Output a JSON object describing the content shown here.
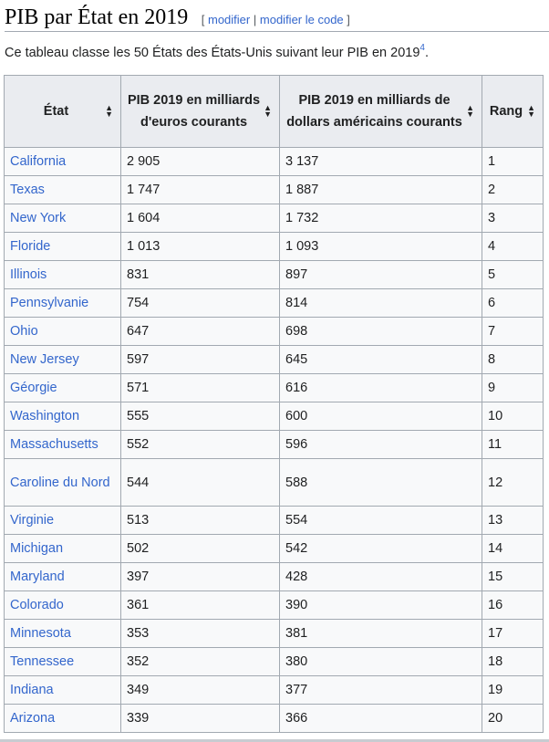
{
  "heading": {
    "title": "PIB par État en 2019",
    "edit_open": "[",
    "edit_label": "modifier",
    "edit_sep": "|",
    "edit_code_label": "modifier le code",
    "edit_close": "]"
  },
  "intro": {
    "text": "Ce tableau classe les 50 États des États-Unis suivant leur PIB en 2019",
    "ref": "4",
    "end": "."
  },
  "table": {
    "headers": [
      "État",
      "PIB 2019 en milliards d'euros courants",
      "PIB 2019 en milliards de dollars américains courants",
      "Rang"
    ],
    "sort_icon": "sort-arrows-icon",
    "rows": [
      {
        "state": "California",
        "eur": "2 905",
        "usd": "3 137",
        "rank": "1"
      },
      {
        "state": "Texas",
        "eur": "1 747",
        "usd": "1 887",
        "rank": "2"
      },
      {
        "state": "New York",
        "eur": "1 604",
        "usd": "1 732",
        "rank": "3"
      },
      {
        "state": "Floride",
        "eur": "1 013",
        "usd": "1 093",
        "rank": "4"
      },
      {
        "state": "Illinois",
        "eur": "831",
        "usd": "897",
        "rank": "5"
      },
      {
        "state": "Pennsylvanie",
        "eur": "754",
        "usd": "814",
        "rank": "6"
      },
      {
        "state": "Ohio",
        "eur": "647",
        "usd": "698",
        "rank": "7"
      },
      {
        "state": "New Jersey",
        "eur": "597",
        "usd": "645",
        "rank": "8"
      },
      {
        "state": "Géorgie",
        "eur": "571",
        "usd": "616",
        "rank": "9"
      },
      {
        "state": "Washington",
        "eur": "555",
        "usd": "600",
        "rank": "10"
      },
      {
        "state": "Massachusetts",
        "eur": "552",
        "usd": "596",
        "rank": "11"
      },
      {
        "state": "Caroline du Nord",
        "eur": "544",
        "usd": "588",
        "rank": "12"
      },
      {
        "state": "Virginie",
        "eur": "513",
        "usd": "554",
        "rank": "13"
      },
      {
        "state": "Michigan",
        "eur": "502",
        "usd": "542",
        "rank": "14"
      },
      {
        "state": "Maryland",
        "eur": "397",
        "usd": "428",
        "rank": "15"
      },
      {
        "state": "Colorado",
        "eur": "361",
        "usd": "390",
        "rank": "16"
      },
      {
        "state": "Minnesota",
        "eur": "353",
        "usd": "381",
        "rank": "17"
      },
      {
        "state": "Tennessee",
        "eur": "352",
        "usd": "380",
        "rank": "18"
      },
      {
        "state": "Indiana",
        "eur": "349",
        "usd": "377",
        "rank": "19"
      },
      {
        "state": "Arizona",
        "eur": "339",
        "usd": "366",
        "rank": "20"
      }
    ]
  },
  "colors": {
    "link": "#3366cc",
    "border": "#a2a9b1",
    "header_bg": "#eaecf0",
    "cell_bg": "#f8f9fa"
  }
}
